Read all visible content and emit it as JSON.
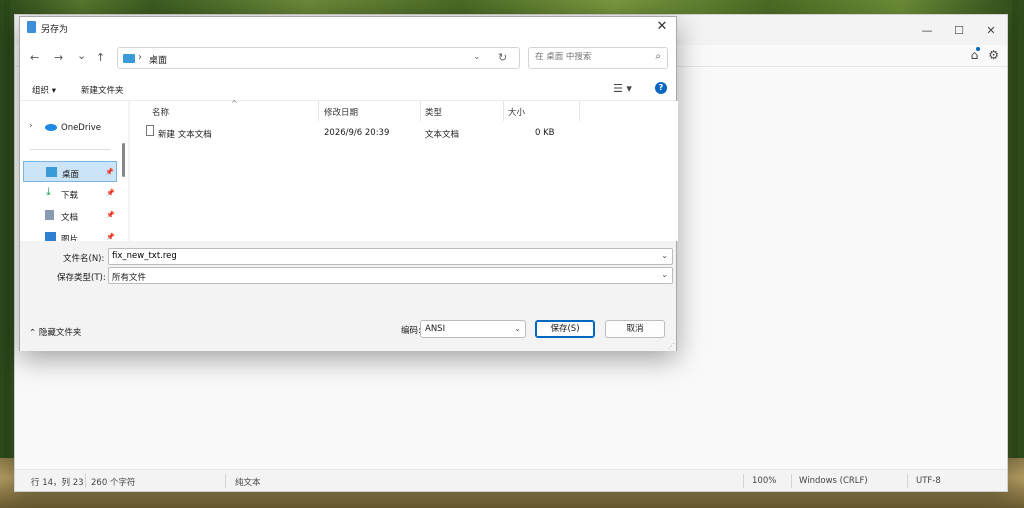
{
  "dialog": {
    "title": "另存为",
    "nav": {
      "back": "←",
      "forward": "→",
      "recent": "⌄",
      "up": "↑"
    },
    "address": {
      "path": "桌面"
    },
    "search": {
      "placeholder": "在 桌面 中搜索"
    },
    "commands": {
      "organize": "组织",
      "new_folder": "新建文件夹"
    },
    "sidebar": {
      "onedrive": "OneDrive",
      "items": [
        {
          "label": "桌面",
          "icon": "desktop-icon",
          "color": "#3a9bd8"
        },
        {
          "label": "下载",
          "icon": "download-icon",
          "color": "#1a9e5c"
        },
        {
          "label": "文档",
          "icon": "document-icon",
          "color": "#6a7a90"
        },
        {
          "label": "图片",
          "icon": "picture-icon",
          "color": "#2f7fd0"
        }
      ]
    },
    "columns": {
      "name": "名称",
      "modified": "修改日期",
      "type": "类型",
      "size": "大小"
    },
    "files": [
      {
        "name": "新建 文本文档",
        "modified": "2026/9/6 20:39",
        "type": "文本文档",
        "size": "0 KB"
      }
    ],
    "filename": {
      "label": "文件名(N):",
      "value": "fix_new_txt.reg"
    },
    "filetype": {
      "label": "保存类型(T):",
      "value": "所有文件"
    },
    "hide_folders": "隐藏文件夹",
    "encoding": {
      "label": "编码:",
      "value": "ANSI"
    },
    "save_button": "保存(S)",
    "cancel_button": "取消"
  },
  "notepad": {
    "status": {
      "position": "行 14，列 23",
      "chars": "260 个字符",
      "format": "纯文本",
      "zoom": "100%",
      "line_ending": "Windows (CRLF)",
      "encoding": "UTF-8"
    }
  },
  "colors": {
    "accent": "#0067c0",
    "selection": "#cce4f7"
  }
}
